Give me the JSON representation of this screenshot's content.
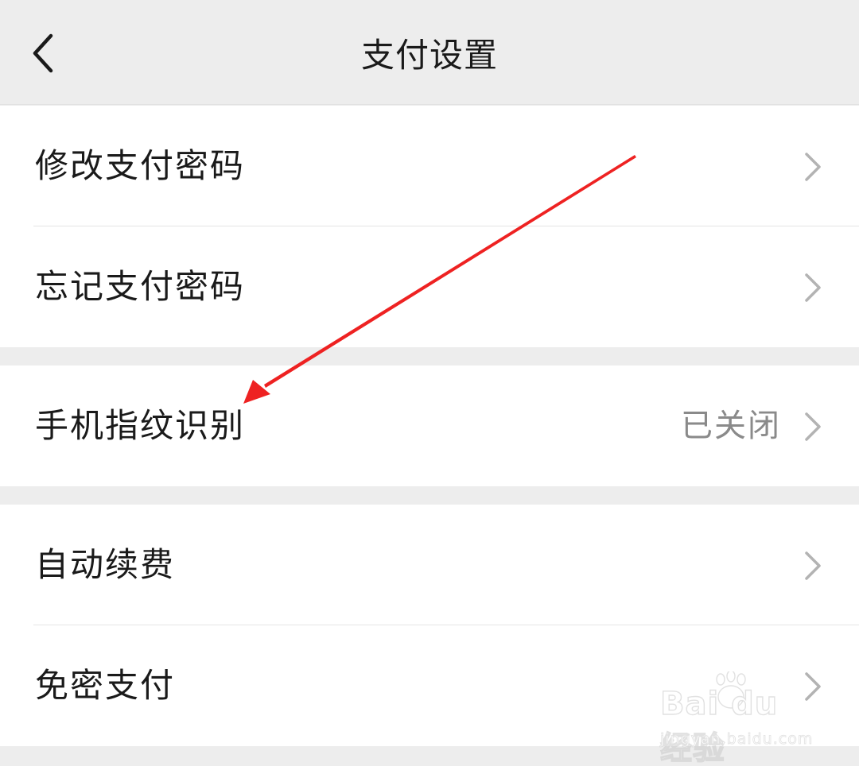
{
  "header": {
    "title": "支付设置",
    "back_icon": "chevron-left-icon"
  },
  "groups": [
    {
      "items": [
        {
          "label": "修改支付密码",
          "value": "",
          "icon": "chevron-right-icon"
        },
        {
          "label": "忘记支付密码",
          "value": "",
          "icon": "chevron-right-icon"
        }
      ]
    },
    {
      "items": [
        {
          "label": "手机指纹识别",
          "value": "已关闭",
          "icon": "chevron-right-icon"
        }
      ]
    },
    {
      "items": [
        {
          "label": "自动续费",
          "value": "",
          "icon": "chevron-right-icon"
        },
        {
          "label": "免密支付",
          "value": "",
          "icon": "chevron-right-icon"
        }
      ]
    }
  ],
  "annotation": {
    "type": "red-arrow",
    "color": "#ee2222",
    "points_to": "手机指纹识别"
  },
  "watermark": {
    "brand": "Bai du 经验",
    "sub": "jingyan.baidu.com",
    "icon": "paw-icon"
  },
  "colors": {
    "background": "#ededed",
    "card": "#ffffff",
    "text": "#1a1a1a",
    "secondary_text": "#8a8a8a",
    "chevron": "#b3b3b3"
  }
}
